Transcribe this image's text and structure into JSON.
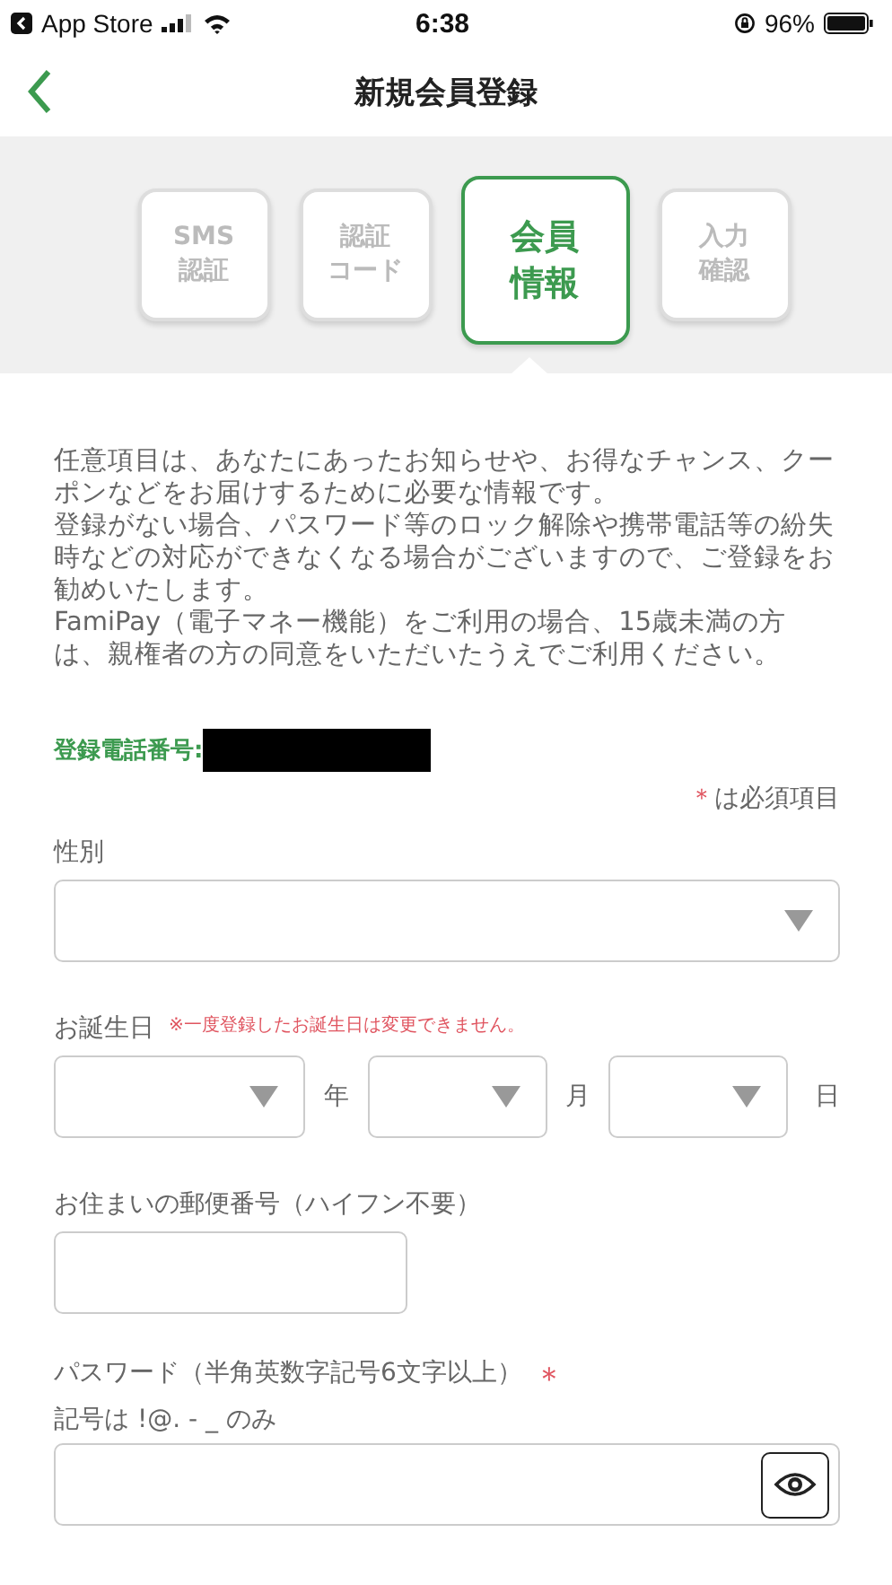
{
  "status_bar": {
    "back_app": "App Store",
    "time": "6:38",
    "battery": "96%"
  },
  "nav": {
    "title": "新規会員登録"
  },
  "steps": [
    {
      "lines": [
        "SMS",
        "認証"
      ],
      "selected": false
    },
    {
      "lines": [
        "認証",
        "コード"
      ],
      "selected": false
    },
    {
      "lines": [
        "会員",
        "情報"
      ],
      "selected": true
    },
    {
      "lines": [
        "入力",
        "確認"
      ],
      "selected": false
    }
  ],
  "intro": [
    "任意項目は、あなたにあったお知らせや、お得なチャンス、クーポンなどをお届けするために必要な情報です。",
    "登録がない場合、パスワード等のロック解除や携帯電話等の紛失時などの対応ができなくなる場合がございますので、ご登録をお勧めいたします。",
    "FamiPay（電子マネー機能）をご利用の場合、15歳未満の方は、親権者の方の同意をいただいたうえでご利用ください。"
  ],
  "phone_label": "登録電話番号:",
  "required_note": {
    "mark": "＊",
    "text": "は必須項目"
  },
  "gender": {
    "label": "性別"
  },
  "birthday": {
    "label": "お誕生日",
    "note": "※一度登録したお誕生日は変更できません。",
    "units": [
      "年",
      "月",
      "日"
    ]
  },
  "postal": {
    "label": "お住まいの郵便番号（ハイフン不要）"
  },
  "password": {
    "label": "パスワード（半角英数字記号6文字以上）",
    "required_mark": "＊",
    "hint": "記号は !@. - _ のみ"
  }
}
